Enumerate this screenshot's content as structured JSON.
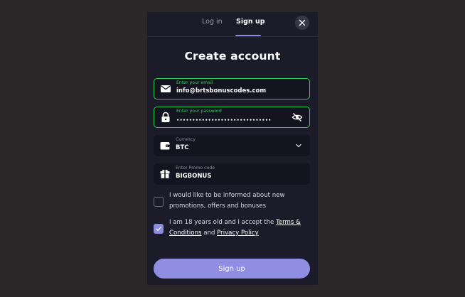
{
  "tabs": {
    "login": "Log in",
    "signup": "Sign up"
  },
  "title": "Create account",
  "email": {
    "label": "Enter your email",
    "value": "info@brtsbonuscodes.com",
    "icon": "envelope-icon"
  },
  "password": {
    "label": "Enter your password",
    "value": "••••••••••••••••••••••••••••••",
    "icon": "lock-icon",
    "toggle_icon": "eye-off-icon"
  },
  "currency": {
    "label": "Currency",
    "value": "BTC",
    "icon": "wallet-icon"
  },
  "promo": {
    "label": "Enter Promo code",
    "value": "BIGBONUS",
    "icon": "gift-icon"
  },
  "newsletter": {
    "text": "I would like to be informed about new promotions, offers and bonuses",
    "checked": false
  },
  "terms": {
    "prefix": "I am 18 years old and I accept the ",
    "terms_link": "Terms & Conditions",
    "middle": " and ",
    "privacy_link": "Privacy Policy",
    "checked": true
  },
  "submit_label": "Sign up",
  "colors": {
    "accent": "#8d8be0",
    "focus": "#2bd14b",
    "panel": "#1c1b29",
    "backdrop": "#2a2828"
  }
}
